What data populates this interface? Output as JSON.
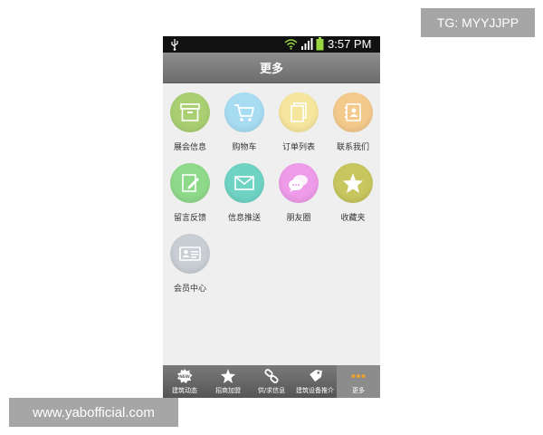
{
  "overlays": {
    "tg_badge": "TG: MYYJJPP",
    "watermark": "www.yabofficial.com"
  },
  "status_bar": {
    "time": "3:57 PM",
    "icons": [
      "usb-icon",
      "wifi-icon",
      "signal-icon",
      "battery-icon"
    ]
  },
  "header": {
    "title": "更多"
  },
  "grid": {
    "items": [
      {
        "label": "展会信息",
        "icon": "box-icon",
        "color": "#a9cf72"
      },
      {
        "label": "购物车",
        "icon": "cart-icon",
        "color": "#a7dcf3"
      },
      {
        "label": "订单列表",
        "icon": "document-icon",
        "color": "#f6e59c"
      },
      {
        "label": "联系我们",
        "icon": "contacts-icon",
        "color": "#f3c98c"
      },
      {
        "label": "留言反馈",
        "icon": "edit-icon",
        "color": "#8fd98b"
      },
      {
        "label": "信息推送",
        "icon": "envelope-icon",
        "color": "#6fd3c4"
      },
      {
        "label": "朋友圈",
        "icon": "chat-bubbles-icon",
        "color": "#ee9be9"
      },
      {
        "label": "收藏夹",
        "icon": "star-icon",
        "color": "#c8c65e"
      },
      {
        "label": "会员中心",
        "icon": "id-card-icon",
        "color": "#c9cdd4"
      }
    ]
  },
  "bottom_nav": {
    "items": [
      {
        "label": "建筑动态",
        "icon": "new-badge-icon"
      },
      {
        "label": "招商加盟",
        "icon": "star-icon"
      },
      {
        "label": "供/求信息",
        "icon": "link-icon"
      },
      {
        "label": "建筑设备推介",
        "icon": "tag-icon"
      },
      {
        "label": "更多",
        "icon": "more-dots-icon",
        "active_color": "#f0a030"
      }
    ]
  }
}
